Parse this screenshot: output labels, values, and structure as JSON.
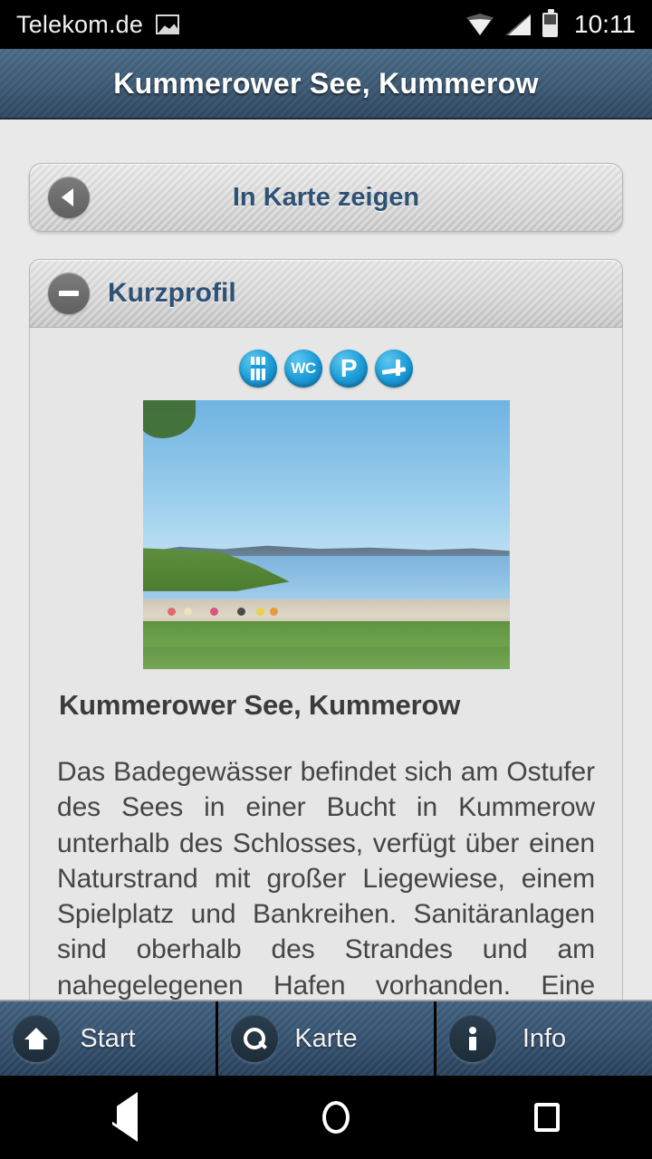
{
  "statusbar": {
    "carrier": "Telekom.de",
    "picture_icon": "picture-icon",
    "wifi_icon": "wifi-icon",
    "signal_icon": "signal-icon",
    "battery_icon": "battery-icon",
    "clock": "10:11"
  },
  "titlebar": {
    "title": "Kummerower See, Kummerow"
  },
  "map_button": {
    "label": "In Karte zeigen",
    "icon": "chevron-left-icon"
  },
  "section": {
    "title": "Kurzprofil",
    "toggle_icon": "minus-circle-icon",
    "amenities": [
      {
        "name": "restaurant-icon",
        "label": ""
      },
      {
        "name": "wc-icon",
        "label": "WC"
      },
      {
        "name": "parking-icon",
        "label": "P"
      },
      {
        "name": "playground-icon",
        "label": ""
      }
    ],
    "photo_alt": "Kummerower See beach photo",
    "place_title": "Kummerower See, Kummerow",
    "description": "Das Badegewässer befindet sich am Ostufer des Sees in einer Bucht in Kummerow unterhalb des Schlosses, verfügt über einen Naturstrand mit großer Liegewiese, einem Spielplatz und Bankreihen. Sanitäranlagen sind oberhalb des Strandes und am nahegelegenen Hafen vorhanden. Eine Imbissversorgung"
  },
  "tabbar": {
    "tabs": [
      {
        "label": "Start",
        "icon": "home-icon"
      },
      {
        "label": "Karte",
        "icon": "search-icon"
      },
      {
        "label": "Info",
        "icon": "info-icon"
      }
    ]
  },
  "navbar": {
    "back": "back-triangle-icon",
    "home": "home-circle-icon",
    "recents": "recents-square-icon"
  },
  "colors": {
    "title_bar": "#3f5d78",
    "accent_text": "#2e5174",
    "page_background": "#e9e9e9",
    "amenity_blue": "#1a9ad6"
  }
}
